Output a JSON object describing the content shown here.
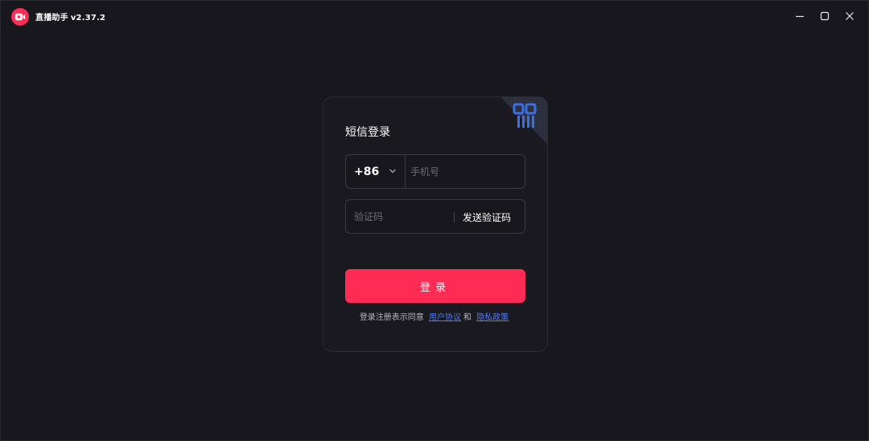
{
  "app": {
    "name": "直播助手",
    "version": "v2.37.2",
    "logo_icon": "camera-icon",
    "accent_color": "#fe2c55"
  },
  "window_controls": {
    "minimize_icon": "minimize-icon",
    "maximize_icon": "maximize-icon",
    "close_icon": "close-icon"
  },
  "login": {
    "title": "短信登录",
    "qr_corner_icon": "qr-code-icon",
    "country_code": "+86",
    "phone_placeholder": "手机号",
    "code_placeholder": "验证码",
    "send_code_label": "发送验证码",
    "submit_label": "登录",
    "agreement_prefix": "登录注册表示同意",
    "user_agreement": "用户协议",
    "conjunction": "和",
    "privacy_policy": "隐私政策",
    "link_color": "#4d7cf5"
  }
}
